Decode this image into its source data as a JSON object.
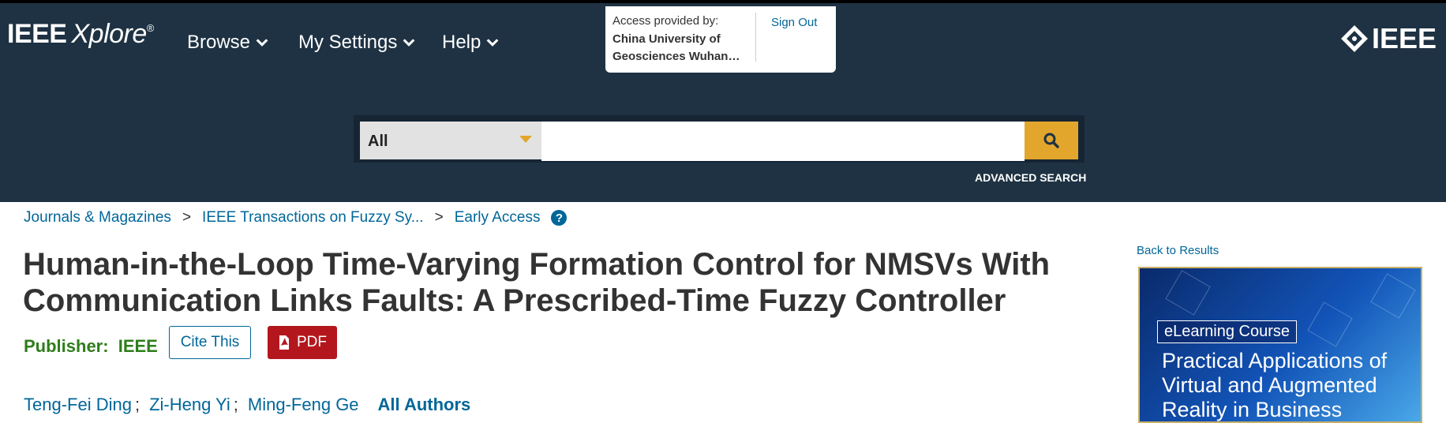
{
  "header": {
    "logo_main": "IEEE",
    "logo_italic": "Xplore",
    "logo_reg": "®",
    "nav": [
      {
        "label": "Browse"
      },
      {
        "label": "My Settings"
      },
      {
        "label": "Help"
      }
    ],
    "access": {
      "label": "Access provided by:",
      "institution": "China University of Geosciences Wuhan…",
      "sign_out": "Sign Out"
    },
    "ieee_logo": "IEEE"
  },
  "search": {
    "scope": "All",
    "query": "",
    "advanced": "ADVANCED SEARCH"
  },
  "breadcrumb": [
    {
      "label": "Journals & Magazines"
    },
    {
      "label": "IEEE Transactions on Fuzzy Sy..."
    },
    {
      "label": "Early Access"
    }
  ],
  "breadcrumb_sep": ">",
  "help_glyph": "?",
  "article": {
    "title": "Human-in-the-Loop Time-Varying Formation Control for NMSVs With Communication Links Faults: A Prescribed-Time Fuzzy Controller",
    "publisher_label": "Publisher:",
    "publisher": "IEEE",
    "cite": "Cite This",
    "pdf": "PDF",
    "authors": [
      "Teng-Fei Ding",
      "Zi-Heng Yi",
      "Ming-Feng Ge"
    ],
    "author_sep": ";",
    "all_authors": "All Authors"
  },
  "sidebar": {
    "back": "Back to Results",
    "ad": {
      "badge": "eLearning Course",
      "headline": "Practical Applications of Virtual and Augmented Reality in Business"
    }
  },
  "colors": {
    "header_bg": "#1e3243",
    "accent": "#e3a62c",
    "link": "#006699",
    "publisher": "#2e7d1b",
    "pdf": "#b3171d"
  }
}
